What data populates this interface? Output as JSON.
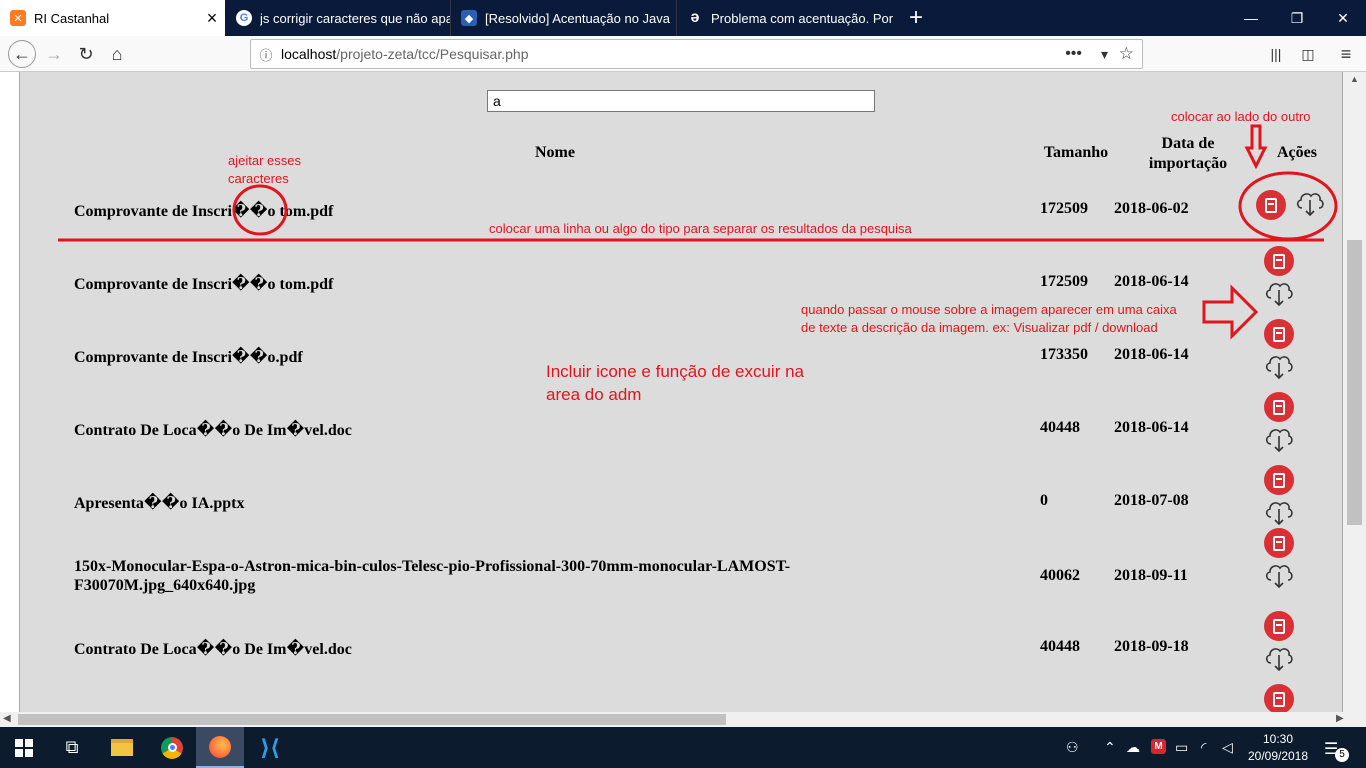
{
  "tabs": [
    {
      "title": "RI Castanhal",
      "icon": "xampp-icon"
    },
    {
      "title": "js corrigir caracteres que não aparecem",
      "icon": "google-icon"
    },
    {
      "title": "[Resolvido] Acentuação no Java",
      "icon": "guj-icon"
    },
    {
      "title": "Problema com acentuação. Por",
      "icon": "stackoverflow-pt-icon"
    }
  ],
  "new_tab_label": "+",
  "window_controls": {
    "minimize": "—",
    "maximize": "❐",
    "close": "✕"
  },
  "url": {
    "host": "localhost",
    "path": "/projeto-zeta/tcc/Pesquisar.php"
  },
  "search_value": "a",
  "table": {
    "headers": {
      "name": "Nome",
      "size": "Tamanho",
      "date": "Data de importação",
      "actions": "Ações"
    },
    "rows": [
      {
        "name": "Comprovante de Inscri��o tom.pdf",
        "size": "172509",
        "date": "2018-06-02"
      },
      {
        "name": "Comprovante de Inscri��o tom.pdf",
        "size": "172509",
        "date": "2018-06-14"
      },
      {
        "name": "Comprovante de Inscri��o.pdf",
        "size": "173350",
        "date": "2018-06-14"
      },
      {
        "name": "Contrato De Loca��o De Im�vel.doc",
        "size": "40448",
        "date": "2018-06-14"
      },
      {
        "name": "Apresenta��o IA.pptx",
        "size": "0",
        "date": "2018-07-08"
      },
      {
        "name": "150x-Monocular-Espa-o-Astron-mica-bin-culos-Telesc-pio-Profissional-300-70mm-monocular-LAMOST-F30070M.jpg_640x640.jpg",
        "size": "40062",
        "date": "2018-09-11"
      },
      {
        "name": "Contrato De Loca��o De Im�vel.doc",
        "size": "40448",
        "date": "2018-09-18"
      }
    ]
  },
  "annotations": {
    "fix_chars": "ajeitar esses\ncaracteres",
    "side_by_side": "colocar ao lado do outro",
    "separator": "colocar uma linha ou algo do tipo para separar os resultados da pesquisa",
    "tooltip": "quando passar o mouse sobre a imagem aparecer em uma caixa\nde texte a descrição da imagem. ex: Visualizar pdf / download",
    "delete": "Incluir icone e função de excuir na\narea do adm"
  },
  "annotation_color": "#e0151e",
  "clock": {
    "time": "10:30",
    "date": "20/09/2018"
  },
  "notification_count": "5"
}
